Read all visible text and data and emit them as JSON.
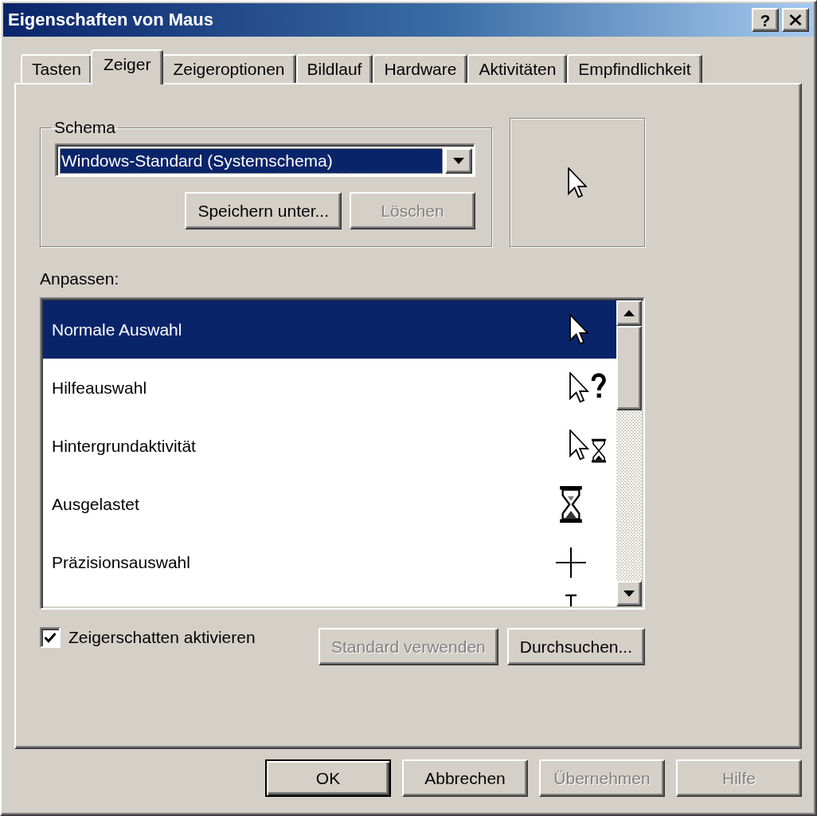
{
  "window": {
    "title": "Eigenschaften von Maus",
    "help_button": "?"
  },
  "tabs": [
    {
      "label": "Tasten",
      "selected": false
    },
    {
      "label": "Zeiger",
      "selected": true
    },
    {
      "label": "Zeigeroptionen",
      "selected": false
    },
    {
      "label": "Bildlauf",
      "selected": false
    },
    {
      "label": "Hardware",
      "selected": false
    },
    {
      "label": "Aktivitäten",
      "selected": false
    },
    {
      "label": "Empfindlichkeit",
      "selected": false
    }
  ],
  "scheme": {
    "label": "Schema",
    "value": "Windows-Standard (Systemschema)",
    "focused": true,
    "buttons": [
      {
        "label": "Speichern unter...",
        "disabled": false
      },
      {
        "label": "Löschen",
        "disabled": true
      }
    ]
  },
  "customize": {
    "label": "Anpassen:",
    "items": [
      {
        "label": "Normale Auswahl",
        "kind": "arrow",
        "selected": true
      },
      {
        "label": "Hilfeauswahl",
        "kind": "help",
        "selected": false
      },
      {
        "label": "Hintergrundaktivität",
        "kind": "working",
        "selected": false
      },
      {
        "label": "Ausgelastet",
        "kind": "busy",
        "selected": false
      },
      {
        "label": "Präzisionsauswahl",
        "kind": "precision",
        "selected": false
      },
      {
        "kind": "text",
        "selected": false
      }
    ]
  },
  "shadow": {
    "label": "Zeigerschatten aktivieren",
    "checked": true
  },
  "cursor_buttons": [
    {
      "label": "Standard verwenden",
      "disabled": true
    },
    {
      "label": "Durchsuchen...",
      "disabled": false
    }
  ],
  "dialog_buttons": [
    {
      "label": "OK",
      "default": true,
      "disabled": false
    },
    {
      "label": "Abbrechen",
      "default": false,
      "disabled": false
    },
    {
      "label": "Übernehmen",
      "default": false,
      "disabled": true
    },
    {
      "label": "Hilfe",
      "default": false,
      "disabled": true
    }
  ]
}
